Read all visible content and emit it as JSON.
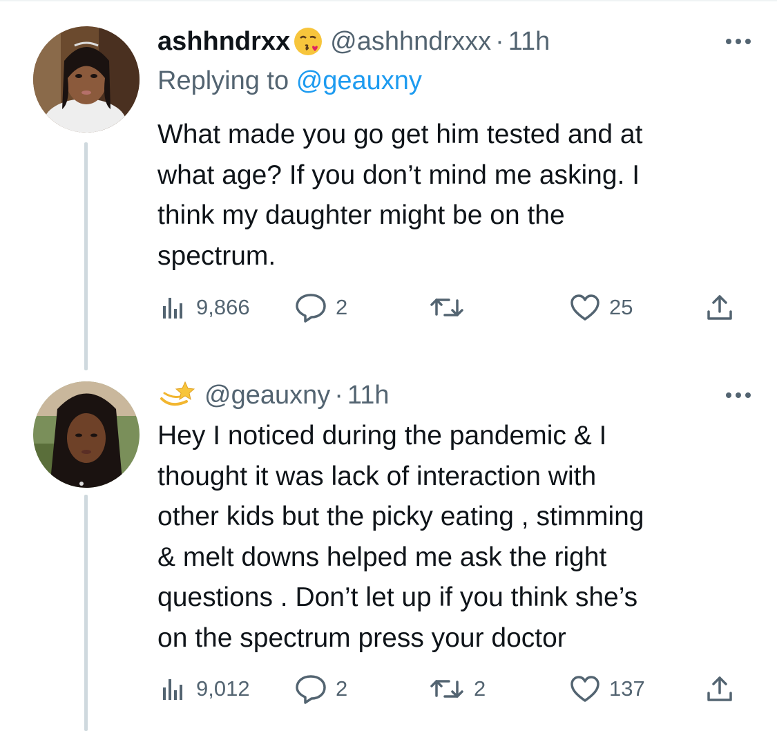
{
  "tweets": [
    {
      "display_name": "ashhndrxx",
      "name_emoji": "kissing-face-emoji",
      "handle": "@ashhndrxxx",
      "time": "11h",
      "replying_label": "Replying to",
      "replying_to": "@geauxny",
      "text": "What made you go get him tested and at\nwhat age? If you don’t mind me asking. I\nthink my daughter might be on the\nspectrum.",
      "views": "9,866",
      "replies": "2",
      "retweets": "",
      "likes": "25"
    },
    {
      "display_name_emoji": "dizzy-star-emoji",
      "handle": "@geauxny",
      "time": "11h",
      "text": "Hey I noticed during the pandemic & I\nthought it was lack of interaction with\nother kids but the picky eating , stimming\n& melt downs helped me ask the right\nquestions . Don’t let up if you think she’s\non the spectrum press your doctor",
      "views": "9,012",
      "replies": "2",
      "retweets": "2",
      "likes": "137"
    }
  ],
  "separator": "·",
  "colors": {
    "text": "#0f1419",
    "secondary": "#536471",
    "link": "#1d9bf0",
    "thread_line": "#cfd9de"
  }
}
